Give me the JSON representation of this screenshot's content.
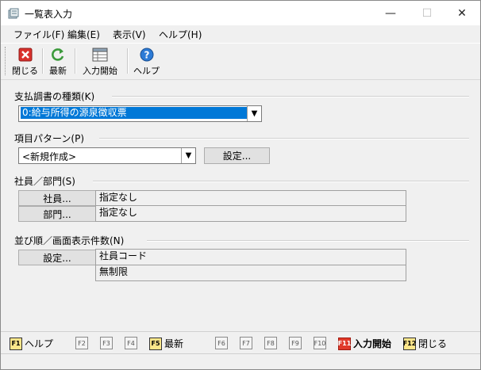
{
  "window": {
    "title": "一覧表入力",
    "minimize_glyph": "—",
    "maximize_glyph": "☐",
    "close_glyph": "✕"
  },
  "menu": [
    "ファイル(F)",
    "編集(E)",
    "表示(V)",
    "ヘルプ(H)"
  ],
  "toolbar": {
    "close_label": "閉じる",
    "refresh_label": "最新",
    "input_start_label": "入力開始",
    "help_label": "ヘルプ"
  },
  "form": {
    "doc_type_label": "支払調書の種類(K)",
    "doc_type_value": "0:給与所得の源泉徴収票",
    "pattern_label": "項目パターン(P)",
    "pattern_value": "<新規作成>",
    "pattern_settings_button": "設定...",
    "emp_dept_label": "社員／部門(S)",
    "employee_button": "社員...",
    "employee_value": "指定なし",
    "department_button": "部門...",
    "department_value": "指定なし",
    "order_label": "並び順／画面表示件数(N)",
    "order_settings_button": "設定...",
    "order_value": "社員コード",
    "count_value": "無制限"
  },
  "fkeys": {
    "f1": {
      "key": "F1",
      "label": "ヘルプ"
    },
    "f2": {
      "key": "F2"
    },
    "f3": {
      "key": "F3"
    },
    "f4": {
      "key": "F4"
    },
    "f5": {
      "key": "F5",
      "label": "最新"
    },
    "f6": {
      "key": "F6"
    },
    "f7": {
      "key": "F7"
    },
    "f8": {
      "key": "F8"
    },
    "f9": {
      "key": "F9"
    },
    "f10": {
      "key": "F10"
    },
    "f11": {
      "key": "F11",
      "label": "入力開始"
    },
    "f12": {
      "key": "F12",
      "label": "閉じる"
    }
  },
  "colors": {
    "selection": "#0078d7",
    "close_icon": "#d9302c",
    "refresh_icon": "#3c9a3c",
    "help_icon": "#2d7bd6"
  }
}
